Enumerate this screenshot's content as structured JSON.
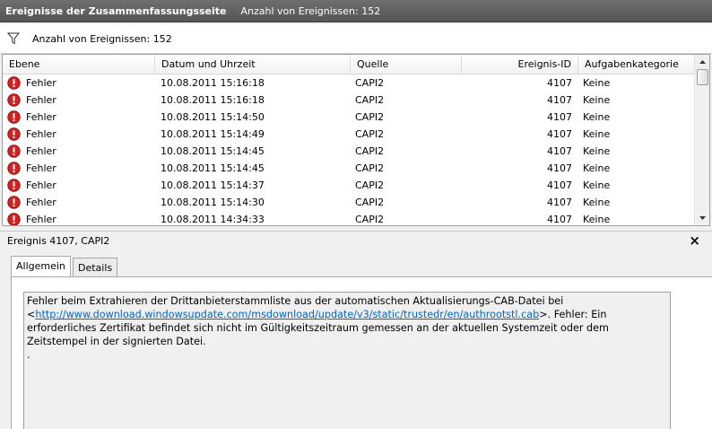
{
  "window": {
    "title": "Ereignisse der Zusammenfassungsseite",
    "subtitle": "Anzahl von Ereignissen: 152"
  },
  "filter": {
    "icon": "filter-icon",
    "label": "Anzahl von Ereignissen: 152"
  },
  "table": {
    "columns": [
      "Ebene",
      "Datum und Uhrzeit",
      "Quelle",
      "Ereignis-ID",
      "Aufgabenkategorie"
    ],
    "rows": [
      {
        "level": "Fehler",
        "date": "10.08.2011 15:16:18",
        "source": "CAPI2",
        "id": "4107",
        "category": "Keine"
      },
      {
        "level": "Fehler",
        "date": "10.08.2011 15:16:18",
        "source": "CAPI2",
        "id": "4107",
        "category": "Keine"
      },
      {
        "level": "Fehler",
        "date": "10.08.2011 15:14:50",
        "source": "CAPI2",
        "id": "4107",
        "category": "Keine"
      },
      {
        "level": "Fehler",
        "date": "10.08.2011 15:14:49",
        "source": "CAPI2",
        "id": "4107",
        "category": "Keine"
      },
      {
        "level": "Fehler",
        "date": "10.08.2011 15:14:45",
        "source": "CAPI2",
        "id": "4107",
        "category": "Keine"
      },
      {
        "level": "Fehler",
        "date": "10.08.2011 15:14:45",
        "source": "CAPI2",
        "id": "4107",
        "category": "Keine"
      },
      {
        "level": "Fehler",
        "date": "10.08.2011 15:14:37",
        "source": "CAPI2",
        "id": "4107",
        "category": "Keine"
      },
      {
        "level": "Fehler",
        "date": "10.08.2011 15:14:30",
        "source": "CAPI2",
        "id": "4107",
        "category": "Keine"
      },
      {
        "level": "Fehler",
        "date": "10.08.2011 14:34:33",
        "source": "CAPI2",
        "id": "4107",
        "category": "Keine"
      }
    ],
    "error_icon": "error-icon",
    "error_color": "#d32020"
  },
  "detail": {
    "title": "Ereignis 4107, CAPI2",
    "close": "×",
    "tabs": [
      "Allgemein",
      "Details"
    ],
    "message_before": "Fehler beim Extrahieren der Drittanbieterstammliste aus der automatischen Aktualisierungs-CAB-Datei bei <",
    "message_link": "http://www.download.windowsupdate.com/msdownload/update/v3/static/trustedr/en/authrootstl.cab",
    "message_after": ">. Fehler: Ein erforderliches Zertifikat befindet sich nicht im Gültigkeitszeitraum gemessen an der aktuellen Systemzeit oder dem Zeitstempel in der signierten Datei.",
    "message_tail": "."
  }
}
